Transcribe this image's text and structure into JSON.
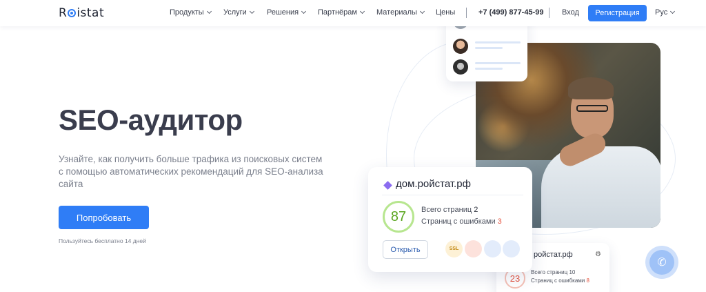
{
  "header": {
    "logo": {
      "pre": "R",
      "post": "istat"
    },
    "nav": [
      {
        "label": "Продукты",
        "dropdown": true
      },
      {
        "label": "Услуги",
        "dropdown": true
      },
      {
        "label": "Решения",
        "dropdown": true
      },
      {
        "label": "Партнёрам",
        "dropdown": true
      },
      {
        "label": "Материалы",
        "dropdown": true
      },
      {
        "label": "Цены",
        "dropdown": false
      }
    ],
    "phone": "+7 (499) 877-45-99",
    "login": "Вход",
    "register": "Регистрация",
    "language": "Рус"
  },
  "hero": {
    "title": "SEO-аудитор",
    "subtitle_line1": "Узнайте, как получить больше трафика из поисковых систем",
    "subtitle_line2": "с помощью автоматических рекомендаций для SEO-анализа сайта",
    "cta": "Попробовать",
    "trial_note": "Пользуйтесь бесплатно 14 дней"
  },
  "site_card": {
    "domain": "дом.ройстат.рф",
    "score": "87",
    "pages_label": "Всего страниц",
    "pages_value": "2",
    "errors_label": "Страниц с ошибками",
    "errors_value": "3",
    "open_button": "Открыть",
    "ssl_badge": "SSL"
  },
  "site_card2": {
    "domain": "ройстат.рф",
    "score": "23",
    "pages_label": "Всего страниц",
    "pages_value": "10",
    "errors_label": "Страниц с ошибками",
    "errors_value": "8"
  },
  "colors": {
    "accent": "#2f7df6",
    "score_good": "#5aa61f",
    "score_bad": "#e5533f",
    "diamond": "#8b6cf0"
  }
}
